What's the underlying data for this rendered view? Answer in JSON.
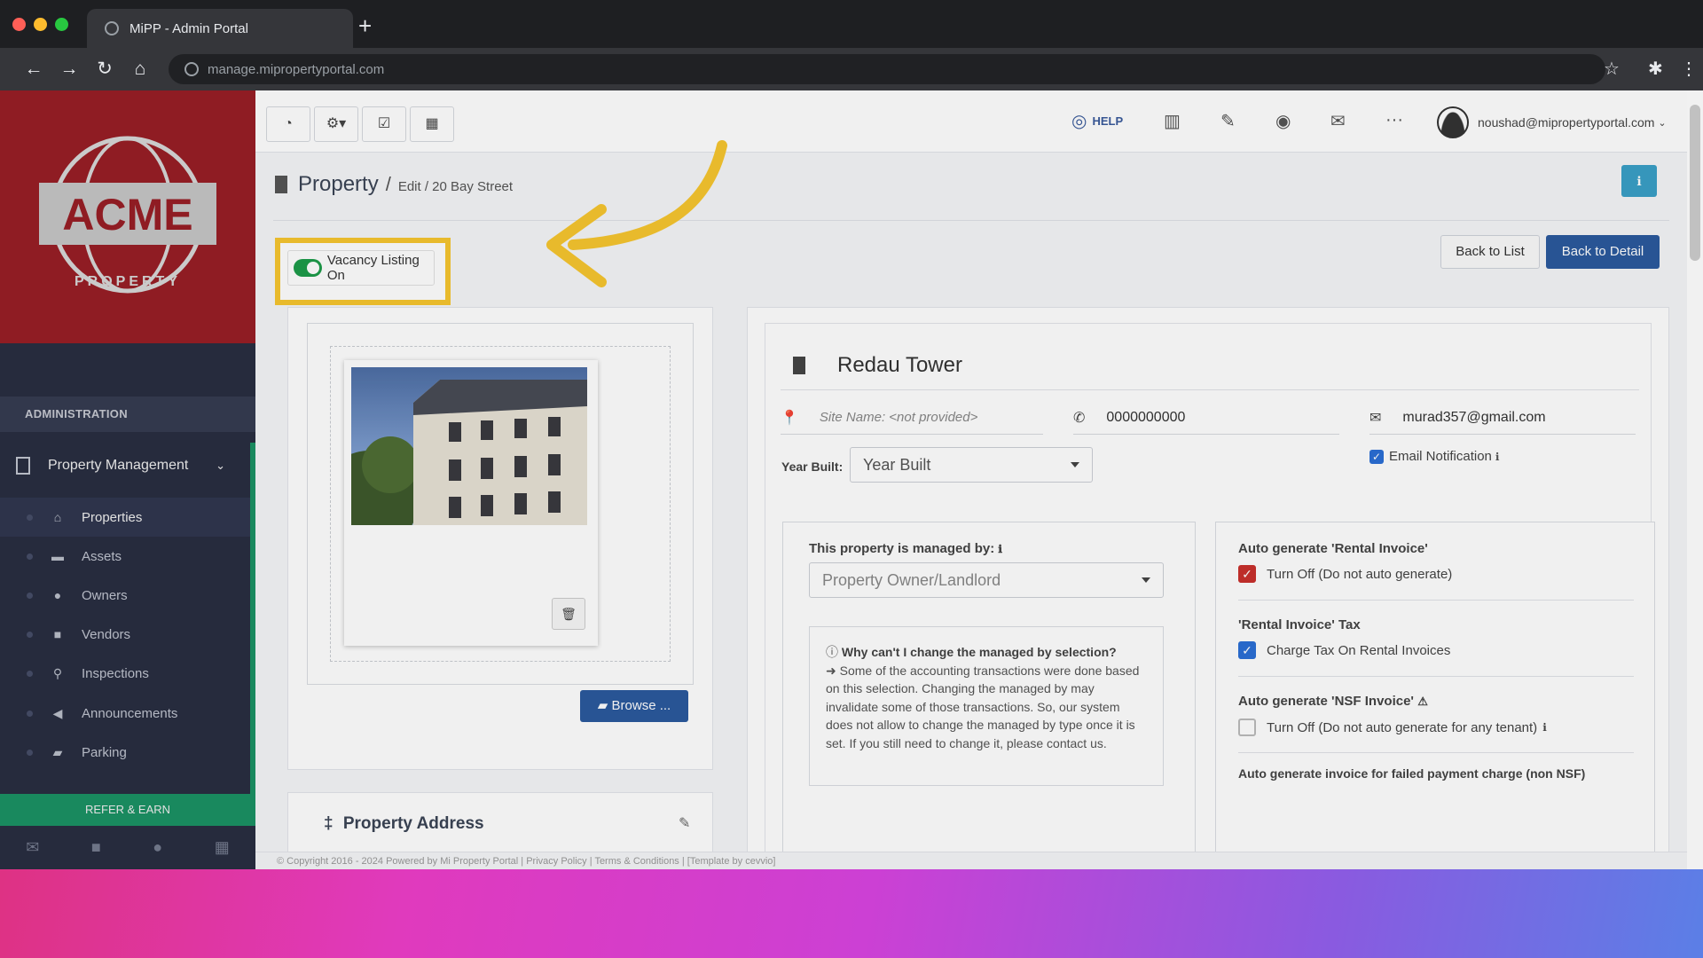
{
  "browser": {
    "tab_title": "MiPP - Admin Portal",
    "new_tab": "+",
    "url": "manage.mipropertyportal.com"
  },
  "sidebar": {
    "logo": {
      "word": "ACME",
      "sub": "PROPERTY"
    },
    "section": "ADMINISTRATION",
    "group": "Property Management",
    "items": [
      {
        "label": "Properties",
        "icon": "home-icon",
        "active": true
      },
      {
        "label": "Assets",
        "icon": "assets-icon"
      },
      {
        "label": "Owners",
        "icon": "user-icon"
      },
      {
        "label": "Vendors",
        "icon": "briefcase-icon"
      },
      {
        "label": "Inspections",
        "icon": "search-icon"
      },
      {
        "label": "Announcements",
        "icon": "megaphone-icon"
      },
      {
        "label": "Parking",
        "icon": "car-icon"
      }
    ],
    "refer": "REFER & EARN"
  },
  "topnav": {
    "help": "HELP",
    "user": "noushad@mipropertyportal.com"
  },
  "breadcrumb": {
    "title": "Property",
    "sep": "/",
    "rest": "Edit / 20 Bay Street"
  },
  "vacancy": {
    "label": "Vacancy Listing On",
    "on": true
  },
  "buttons": {
    "back_list": "Back to List",
    "back_detail": "Back to Detail",
    "browse": "Browse ..."
  },
  "property": {
    "name": "Redau Tower",
    "site_placeholder": "Site Name: <not provided>",
    "phone": "0000000000",
    "email": "murad357@gmail.com",
    "year_label": "Year Built:",
    "year_value": "Year Built",
    "email_notification": "Email Notification"
  },
  "managed": {
    "title": "This property is managed by:",
    "value": "Property Owner/Landlord",
    "note_title": "Why can't I change the managed by selection?",
    "note_body": "Some of the accounting transactions were done based on this selection. Changing the managed by may invalidate some of those transactions. So, our system does not allow to change the managed by type once it is set. If you still need to change it, please contact us."
  },
  "auto": {
    "rental_title": "Auto generate 'Rental Invoice'",
    "rental_opt": "Turn Off (Do not auto generate)",
    "tax_title": "'Rental Invoice' Tax",
    "tax_opt": "Charge Tax On Rental Invoices",
    "nsf_title": "Auto generate 'NSF Invoice'",
    "nsf_opt": "Turn Off (Do not auto generate for any tenant)",
    "failed_title": "Auto generate invoice for failed payment charge (non NSF)"
  },
  "address": {
    "title": "Property Address"
  },
  "footer": "© Copyright 2016 - 2024 Powered by Mi Property Portal | Privacy Policy | Terms & Conditions | [Template by cevvio]",
  "colors": {
    "highlight": "#f7c62f",
    "primary": "#2b5a9e",
    "sidebar": "#2c3146",
    "brand": "#a32028",
    "accent": "#1d9c6b"
  }
}
